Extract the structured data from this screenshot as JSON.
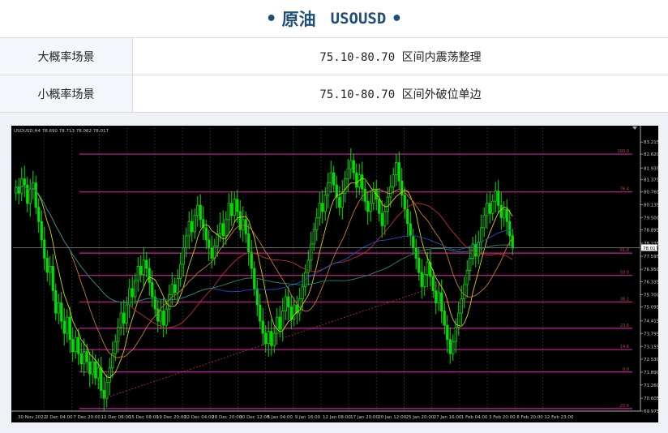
{
  "header": {
    "title": "原油",
    "symbol": "USOUSD"
  },
  "scenarios": [
    {
      "label": "大概率场景",
      "value": "75.10-80.70 区间内震荡整理"
    },
    {
      "label": "小概率场景",
      "value": "75.10-80.70 区间外破位单边"
    }
  ],
  "chart_data": {
    "type": "candlestick",
    "timeframe": "H4",
    "info_text": "USOUSD,H4  78.690 78.713 78.062 78.017",
    "current_price": 78.017,
    "ylim": [
      69.975,
      83.94
    ],
    "y_ticks": [
      "83.940",
      "83.215",
      "82.620",
      "81.935",
      "81.375",
      "80.760",
      "80.135",
      "79.500",
      "78.895",
      "78.235",
      "77.595",
      "76.950",
      "76.335",
      "75.700",
      "75.095",
      "74.415",
      "73.795",
      "73.155",
      "72.530",
      "71.890",
      "71.260",
      "70.605",
      "69.975"
    ],
    "x_labels": [
      "30 Nov 2022",
      "2 Dec 04:00",
      "7 Dec 20:00",
      "12 Dec 08:00",
      "15 Dec 08:00",
      "19 Dec 20:00",
      "22 Dec 04:00",
      "28 Dec 20:00",
      "30 Dec 12:00",
      "5 Jan 04:00",
      "9 Jan 16:00",
      "12 Jan 08:00",
      "17 Jan 20:00",
      "20 Jan 12:00",
      "25 Jan 20:00",
      "27 Jan 16:00",
      "1 Feb 04:00",
      "3 Feb 20:00",
      "8 Feb 20:00",
      "12 Feb 23:00"
    ],
    "fib_levels": [
      {
        "price": 82.62,
        "label": "100.0"
      },
      {
        "price": 80.76,
        "label": "76.4"
      },
      {
        "price": 77.75,
        "label": "61.8"
      },
      {
        "price": 76.65,
        "label": "50.0"
      },
      {
        "price": 75.35,
        "label": "38.2"
      },
      {
        "price": 74.05,
        "label": "23.6"
      },
      {
        "price": 73.0,
        "label": "14.6"
      },
      {
        "price": 71.9,
        "label": "0.0"
      },
      {
        "price": 70.1,
        "label": "-23.6"
      }
    ],
    "close_series": [
      81.0,
      80.7,
      81.4,
      81.1,
      80.2,
      80.9,
      81.2,
      80.0,
      79.3,
      78.4,
      77.5,
      76.8,
      77.1,
      75.9,
      74.8,
      75.3,
      74.4,
      73.8,
      74.6,
      73.5,
      72.9,
      73.6,
      72.8,
      72.3,
      72.9,
      72.4,
      71.8,
      72.4,
      71.6,
      72.1,
      71.0,
      70.6,
      71.4,
      72.1,
      72.8,
      73.4,
      74.1,
      74.8,
      74.3,
      75.2,
      76.0,
      75.6,
      76.4,
      77.1,
      76.7,
      77.4,
      77.0,
      76.3,
      75.6,
      75.0,
      74.4,
      74.9,
      74.2,
      75.0,
      75.7,
      76.2,
      75.8,
      76.5,
      77.2,
      78.0,
      78.6,
      79.3,
      78.8,
      79.6,
      80.1,
      79.4,
      79.0,
      78.4,
      78.0,
      77.5,
      78.1,
      78.7,
      79.2,
      78.6,
      79.4,
      80.2,
      79.6,
      80.4,
      79.8,
      78.9,
      79.4,
      78.7,
      77.8,
      77.0,
      76.0,
      75.2,
      74.4,
      73.8,
      73.3,
      73.9,
      73.2,
      73.8,
      74.6,
      74.0,
      74.9,
      75.6,
      75.1,
      74.5,
      75.2,
      74.8,
      75.5,
      76.1,
      76.8,
      77.4,
      78.2,
      78.9,
      79.5,
      80.2,
      79.8,
      80.6,
      81.2,
      81.7,
      81.1,
      80.5,
      80.0,
      80.7,
      81.4,
      81.9,
      82.3,
      81.7,
      81.0,
      81.6,
      80.9,
      80.3,
      79.8,
      80.2,
      80.9,
      80.4,
      79.7,
      79.1,
      79.8,
      80.5,
      81.0,
      81.6,
      82.2,
      81.3,
      80.6,
      79.9,
      79.2,
      78.6,
      78.0,
      77.5,
      76.8,
      76.1,
      76.7,
      77.3,
      76.6,
      75.9,
      75.3,
      75.8,
      74.9,
      74.2,
      73.5,
      72.8,
      73.4,
      74.1,
      74.8,
      75.5,
      76.2,
      76.9,
      77.5,
      78.2,
      77.6,
      78.3,
      79.0,
      79.6,
      80.2,
      79.7,
      80.3,
      80.8,
      80.1,
      79.5,
      79.9,
      79.3,
      78.6,
      78.0
    ]
  }
}
